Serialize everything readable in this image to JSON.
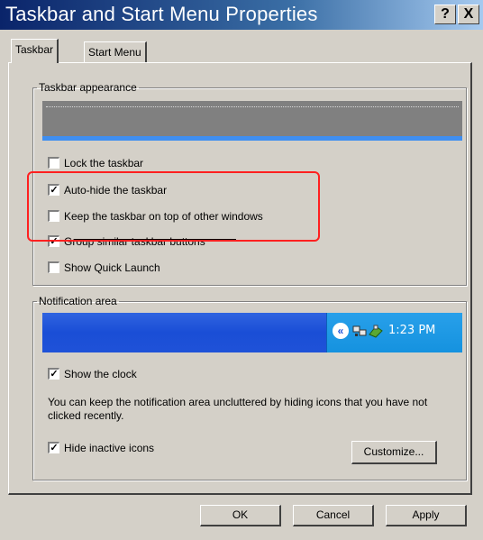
{
  "window": {
    "title": "Taskbar and Start Menu Properties",
    "help_label": "?",
    "close_label": "X"
  },
  "tabs": [
    {
      "label": "Taskbar",
      "active": true
    },
    {
      "label": "Start Menu",
      "active": false
    }
  ],
  "taskbar_appearance": {
    "legend": "Taskbar appearance",
    "options": [
      {
        "label": "Lock the taskbar",
        "checked": false
      },
      {
        "label": "Auto-hide the taskbar",
        "checked": true
      },
      {
        "label": "Keep the taskbar on top of other windows",
        "checked": false
      },
      {
        "label": "Group similar taskbar buttons",
        "checked": true
      },
      {
        "label": "Show Quick Launch",
        "checked": false
      }
    ]
  },
  "notification_area": {
    "legend": "Notification area",
    "preview_time": "1:23 PM",
    "show_clock": {
      "label": "Show the clock",
      "checked": true
    },
    "description": "You can keep the notification area uncluttered by hiding icons that you have not clicked recently.",
    "hide_inactive": {
      "label": "Hide inactive icons",
      "checked": true
    },
    "customize_label": "Customize..."
  },
  "buttons": {
    "ok": "OK",
    "cancel": "Cancel",
    "apply": "Apply"
  },
  "colors": {
    "annotation_box": "#ff2020",
    "title_bar": "#0a246a",
    "taskbar_blue": "#1f52d8"
  }
}
